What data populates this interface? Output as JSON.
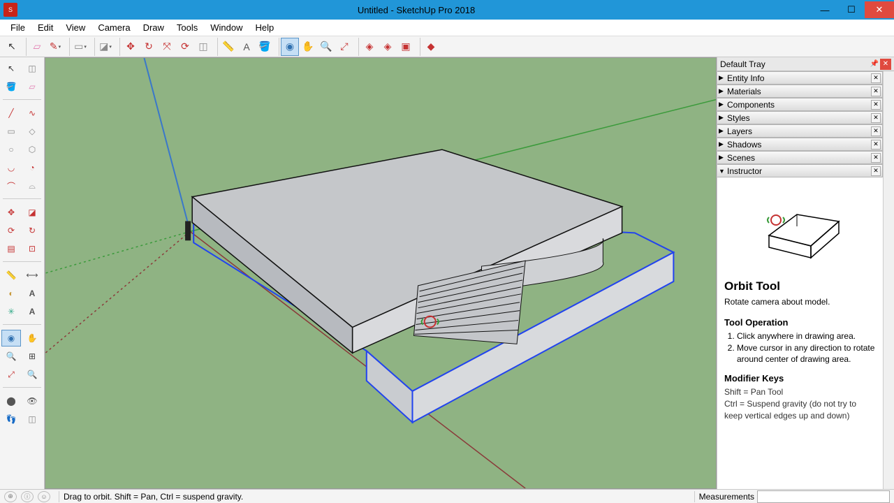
{
  "window": {
    "title": "Untitled - SketchUp Pro 2018"
  },
  "menus": [
    "File",
    "Edit",
    "View",
    "Camera",
    "Draw",
    "Tools",
    "Window",
    "Help"
  ],
  "toolbar_top": [
    {
      "name": "select-arrow",
      "glyph": "↖",
      "color": "#333"
    },
    {
      "sep": true
    },
    {
      "name": "eraser",
      "glyph": "▱",
      "color": "#e27cb1"
    },
    {
      "name": "pencil",
      "glyph": "✎",
      "color": "#c53232",
      "dd": true
    },
    {
      "sep": true
    },
    {
      "name": "rect",
      "glyph": "▭",
      "color": "#8a8a8a",
      "dd": true
    },
    {
      "sep": true
    },
    {
      "name": "pushpull",
      "glyph": "◪",
      "color": "#8a8a8a",
      "dd": true
    },
    {
      "sep": true
    },
    {
      "name": "move",
      "glyph": "✥",
      "color": "#c53232"
    },
    {
      "name": "rotate-drag",
      "glyph": "↻",
      "color": "#c53232"
    },
    {
      "name": "scale",
      "glyph": "⤧",
      "color": "#c53232"
    },
    {
      "name": "rotate",
      "glyph": "⟳",
      "color": "#c53232"
    },
    {
      "name": "offset",
      "glyph": "◫",
      "color": "#8a8a8a"
    },
    {
      "sep": true
    },
    {
      "name": "tape",
      "glyph": "📏",
      "color": "#c89a3e"
    },
    {
      "name": "text",
      "glyph": "A",
      "color": "#555"
    },
    {
      "name": "paint",
      "glyph": "🪣",
      "color": "#c89a3e"
    },
    {
      "sep": true
    },
    {
      "name": "orbit",
      "glyph": "◉",
      "color": "#2f70b0",
      "active": true
    },
    {
      "name": "pan",
      "glyph": "✋",
      "color": "#c89a3e"
    },
    {
      "name": "zoom",
      "glyph": "🔍",
      "color": "#555"
    },
    {
      "name": "zoom-ext",
      "glyph": "⤢",
      "color": "#c53232"
    },
    {
      "sep": true
    },
    {
      "name": "warehouse",
      "glyph": "◈",
      "color": "#c53232"
    },
    {
      "name": "3dw",
      "glyph": "◈",
      "color": "#c53232"
    },
    {
      "name": "ext",
      "glyph": "▣",
      "color": "#c53232"
    },
    {
      "sep": true
    },
    {
      "name": "layout",
      "glyph": "◆",
      "color": "#c53232"
    }
  ],
  "tray": {
    "title": "Default Tray",
    "panels": [
      {
        "label": "Entity Info",
        "open": false
      },
      {
        "label": "Materials",
        "open": false
      },
      {
        "label": "Components",
        "open": false
      },
      {
        "label": "Styles",
        "open": false
      },
      {
        "label": "Layers",
        "open": false
      },
      {
        "label": "Shadows",
        "open": false
      },
      {
        "label": "Scenes",
        "open": false
      },
      {
        "label": "Instructor",
        "open": true
      }
    ],
    "instructor": {
      "title": "Orbit Tool",
      "subtitle": "Rotate camera about model.",
      "op_head": "Tool Operation",
      "ops": [
        "Click anywhere in drawing area.",
        "Move cursor in any direction to rotate around center of drawing area."
      ],
      "mod_head": "Modifier Keys",
      "mods": [
        "Shift = Pan Tool",
        "Ctrl = Suspend gravity (do not try to keep vertical edges up and down)"
      ]
    }
  },
  "status": {
    "hint": "Drag to orbit. Shift = Pan, Ctrl = suspend gravity.",
    "meas_label": "Measurements"
  }
}
